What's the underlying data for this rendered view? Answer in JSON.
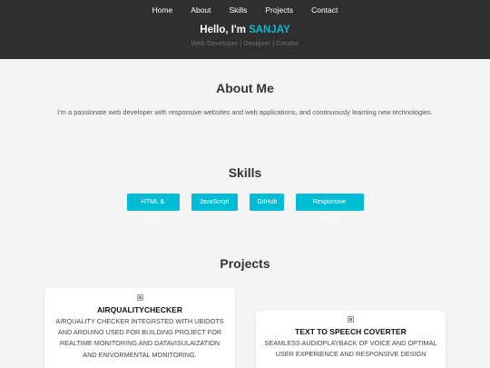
{
  "nav": {
    "items": [
      "Home",
      "About",
      "Skills",
      "Projects",
      "Contact"
    ]
  },
  "hero": {
    "greeting": "Hello, I'm ",
    "name": "SANJAY",
    "subtitle": "Web Developer | Designer | Creator"
  },
  "about": {
    "title": "About Me",
    "text": "I'm a passionate web developer with responsive websites and web applications, and continuously learning new technologies."
  },
  "skills": {
    "title": "Skills",
    "items": [
      "HTML & CSS",
      "JavaScript",
      "GitHub",
      "Responsive Design"
    ]
  },
  "projects": {
    "title": "Projects",
    "items": [
      {
        "title": "AIRQUALITYCHECKER",
        "desc_lines": [
          "AIRQUALITY CHECKER INTEGRSTED WITH UBIDOTS",
          "AND ARDUINO USED FOR BUILDING PROJECT FOR",
          "REALTIME MONITORING AND DATAVISULAIZATION",
          "AND ENIVORMENTAL MONITORING."
        ]
      },
      {
        "title": "TEXT TO SPEECH COVERTER",
        "desc_lines": [
          "SEAMLESS AUDIOPLAYBACK OF VOICE AND OPTIMAL",
          "USER EXPERIENCE AND RESPONSIVE DESIGN"
        ]
      }
    ]
  },
  "colors": {
    "accent": "#00bcd4",
    "header_bg": "#2f2f2f",
    "page_bg": "#f4f4f4"
  }
}
